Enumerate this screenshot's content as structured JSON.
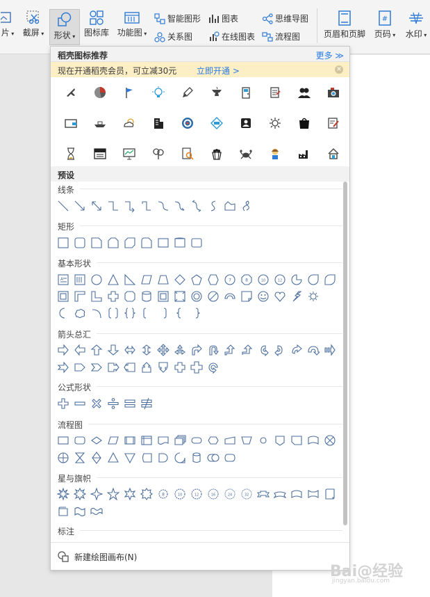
{
  "ribbon": {
    "image_label": "片",
    "screenshot_label": "截屏",
    "shapes_label": "形状",
    "icon_lib_label": "图标库",
    "function_chart_label": "功能图",
    "smart_shape_label": "智能图形",
    "chart_label": "图表",
    "mindmap_label": "思维导图",
    "relation_label": "关系图",
    "online_chart_label": "在线图表",
    "flowchart_label": "流程图",
    "header_footer_label": "页眉和页脚",
    "page_number_label": "页码",
    "watermark_label": "水印"
  },
  "panel": {
    "header": "稻壳图标推荐",
    "more": "更多",
    "promo_text": "现在开通稻壳会员，可立减30元",
    "promo_link": "立即开通 >",
    "preset": "预设",
    "categories": {
      "lines": "线条",
      "rect": "矩形",
      "basic": "基本形状",
      "arrows": "箭头总汇",
      "formula": "公式形状",
      "flow": "流程图",
      "stars": "星与旗帜",
      "callout": "标注"
    },
    "footer": "新建绘图画布(N)"
  },
  "icon_grid": {
    "rows": [
      [
        "plane-icon",
        "pie-chart-icon",
        "flag-icon",
        "bulb-icon",
        "rocket-icon",
        "anvil-icon",
        "door-icon",
        "document-icon",
        "users-icon",
        "camera-icon"
      ],
      [
        "wallet-icon",
        "ship-icon",
        "weather-icon",
        "building-icon",
        "target-icon",
        "badge-icon",
        "contact-icon",
        "gear-icon",
        "bag-icon",
        "edit-icon"
      ],
      [
        "hourglass-icon",
        "sale-sign-icon",
        "presentation-icon",
        "tree-icon",
        "search-doc-icon",
        "popcorn-icon",
        "crab-icon",
        "girl-icon",
        "factory-icon",
        "house-icon"
      ]
    ]
  },
  "colors": {
    "accent": "#2a7ae2",
    "shape_stroke": "#4d6f9e",
    "promo_bg": "#fcefc6"
  },
  "watermark": {
    "text": "Bai@经验",
    "sub": "jingyan.baidu.com"
  }
}
